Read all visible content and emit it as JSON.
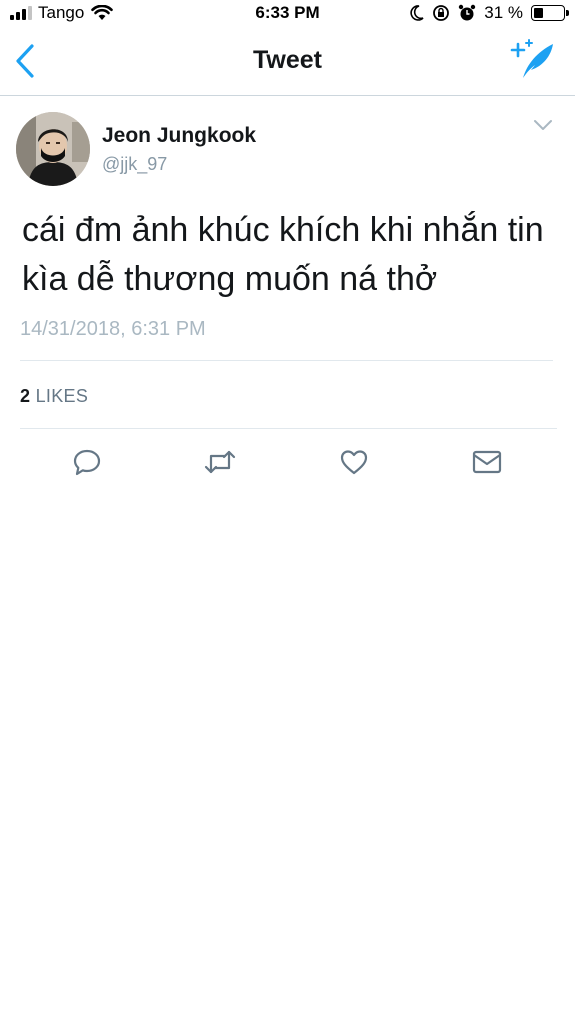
{
  "status_bar": {
    "carrier": "Tango",
    "time": "6:33 PM",
    "battery_percent": "31 %",
    "signal_bars_active": 3,
    "battery_level": 0.31
  },
  "nav": {
    "title": "Tweet",
    "accent_color": "#1da1f2"
  },
  "tweet": {
    "display_name": "Jeon Jungkook",
    "handle": "@jjk_97",
    "text": "cái đm ảnh khúc khích khi nhắn tin kìa dễ thương muốn ná thở",
    "timestamp": "14/31/2018, 6:31 PM",
    "likes_count": "2",
    "likes_label": "LIKES"
  },
  "actions": [
    "reply-icon",
    "retweet-icon",
    "like-icon",
    "share-mail-icon"
  ]
}
